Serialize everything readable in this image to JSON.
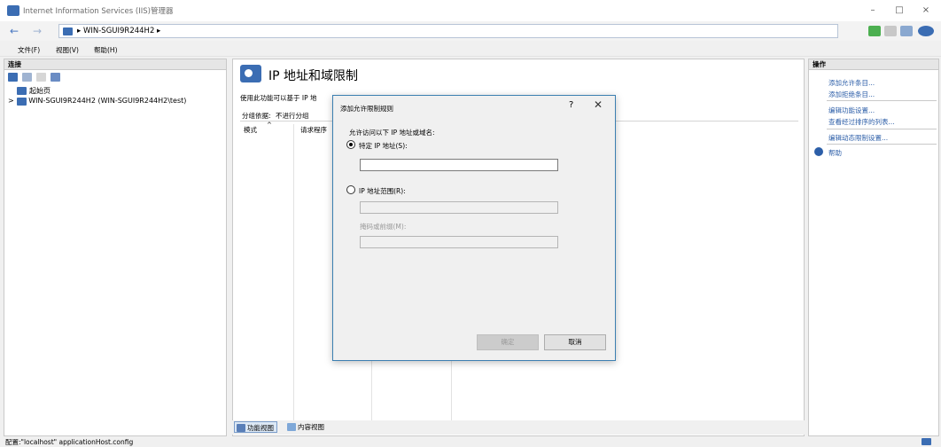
{
  "window": {
    "title": "Internet Information Services (IIS)管理器",
    "minimize": "–",
    "maximize": "□",
    "close": "×"
  },
  "address": {
    "back": "←",
    "forward": "→",
    "path": "▸ WIN-SGUI9R244H2 ▸"
  },
  "menu": [
    "文件(F)",
    "视图(V)",
    "帮助(H)"
  ],
  "left_pane": {
    "header": "连接",
    "tree": [
      {
        "label": "起始页"
      },
      {
        "label": "WIN-SGUI9R244H2 (WIN-SGUI9R244H2\\test)",
        "expander": ">"
      }
    ]
  },
  "center": {
    "title": "IP 地址和域限制",
    "description": "使用此功能可以基于 IP 地",
    "group_by_label": "分组依据:",
    "group_by_value": "不进行分组",
    "columns": [
      "模式",
      "请求程序"
    ],
    "sort_indicator": "^",
    "views": {
      "features": "功能视图",
      "content": "内容视图"
    }
  },
  "actions": {
    "header": "操作",
    "items": [
      "添加允许条目...",
      "添加拒绝条目...",
      "编辑功能设置...",
      "查看经过排序的列表...",
      "编辑动态限制设置...",
      "帮助"
    ]
  },
  "status": {
    "text": "配置:\"localhost\" applicationHost.config"
  },
  "dialog": {
    "title": "添加允许限制规则",
    "help": "?",
    "close": "✕",
    "instruction": "允许访问以下 IP 地址或域名:",
    "radio_specific": "特定 IP 地址(S):",
    "radio_range": "IP 地址范围(R):",
    "mask_label": "掩码或前缀(M):",
    "specific_value": "",
    "range_value": "",
    "mask_value": "",
    "ok": "确定",
    "cancel": "取消"
  },
  "colors": {
    "accent": "#3b6db3",
    "link": "#2c5ea8",
    "dialog_border": "#3c7fb1"
  }
}
